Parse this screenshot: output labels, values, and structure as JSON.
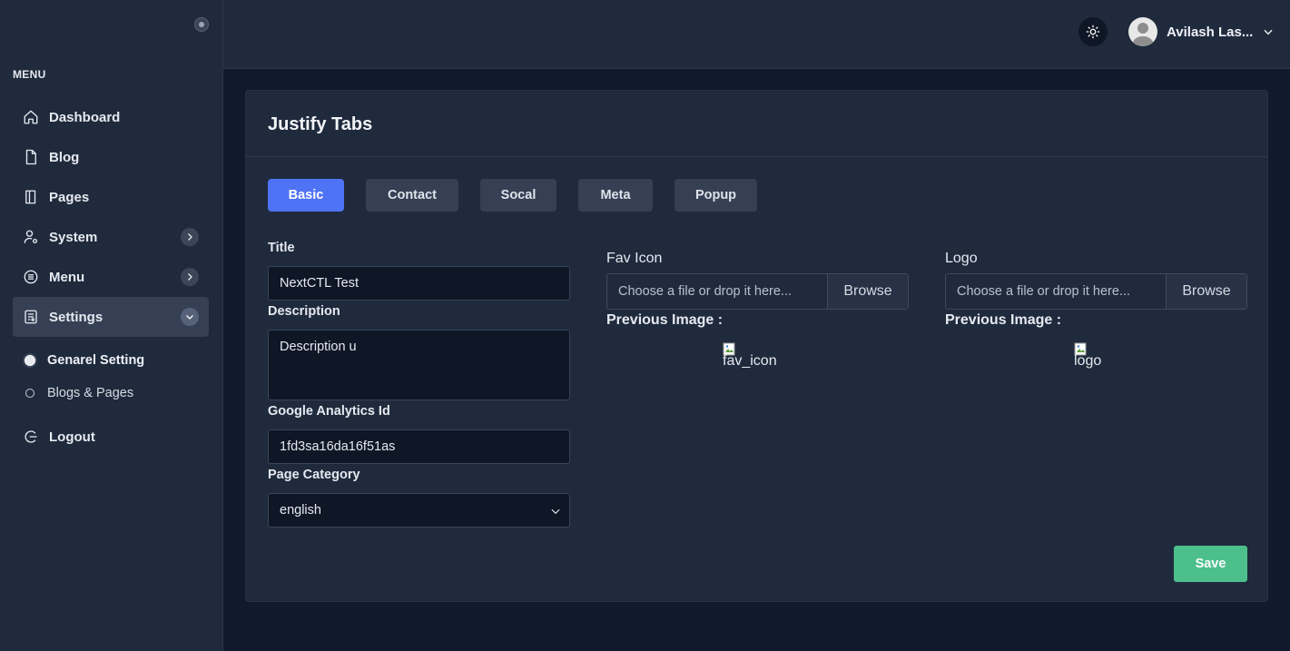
{
  "sidebar": {
    "menu_heading": "MENU",
    "items": [
      {
        "label": "Dashboard",
        "icon": "home-icon"
      },
      {
        "label": "Blog",
        "icon": "file-icon"
      },
      {
        "label": "Pages",
        "icon": "book-icon"
      },
      {
        "label": "System",
        "icon": "user-gear-icon"
      },
      {
        "label": "Menu",
        "icon": "list-icon"
      },
      {
        "label": "Settings",
        "icon": "settings-icon"
      }
    ],
    "sub_items": [
      {
        "label": "Genarel Setting"
      },
      {
        "label": "Blogs & Pages"
      }
    ],
    "logout": "Logout"
  },
  "header": {
    "user_name": "Avilash Las..."
  },
  "card": {
    "title": "Justify Tabs",
    "tabs": [
      "Basic",
      "Contact",
      "Socal",
      "Meta",
      "Popup"
    ],
    "active_tab": "Basic"
  },
  "form": {
    "title_label": "Title",
    "title_value": "NextCTL Test",
    "description_label": "Description",
    "description_value": "Description u",
    "ga_label": "Google Analytics Id",
    "ga_value": "1fd3sa16da16f51as",
    "category_label": "Page Category",
    "category_value": "english"
  },
  "fav_icon": {
    "label": "Fav Icon",
    "placeholder": "Choose a file or drop it here...",
    "browse": "Browse",
    "previous_label": "Previous Image :",
    "alt": "fav_icon"
  },
  "logo": {
    "label": "Logo",
    "placeholder": "Choose a file or drop it here...",
    "browse": "Browse",
    "previous_label": "Previous Image :",
    "alt": "logo"
  },
  "save_label": "Save",
  "colors": {
    "accent": "#4f73f5",
    "save": "#4cbf8b",
    "sidebar_bg": "#1f2a3d",
    "page_bg": "#111a2c"
  }
}
